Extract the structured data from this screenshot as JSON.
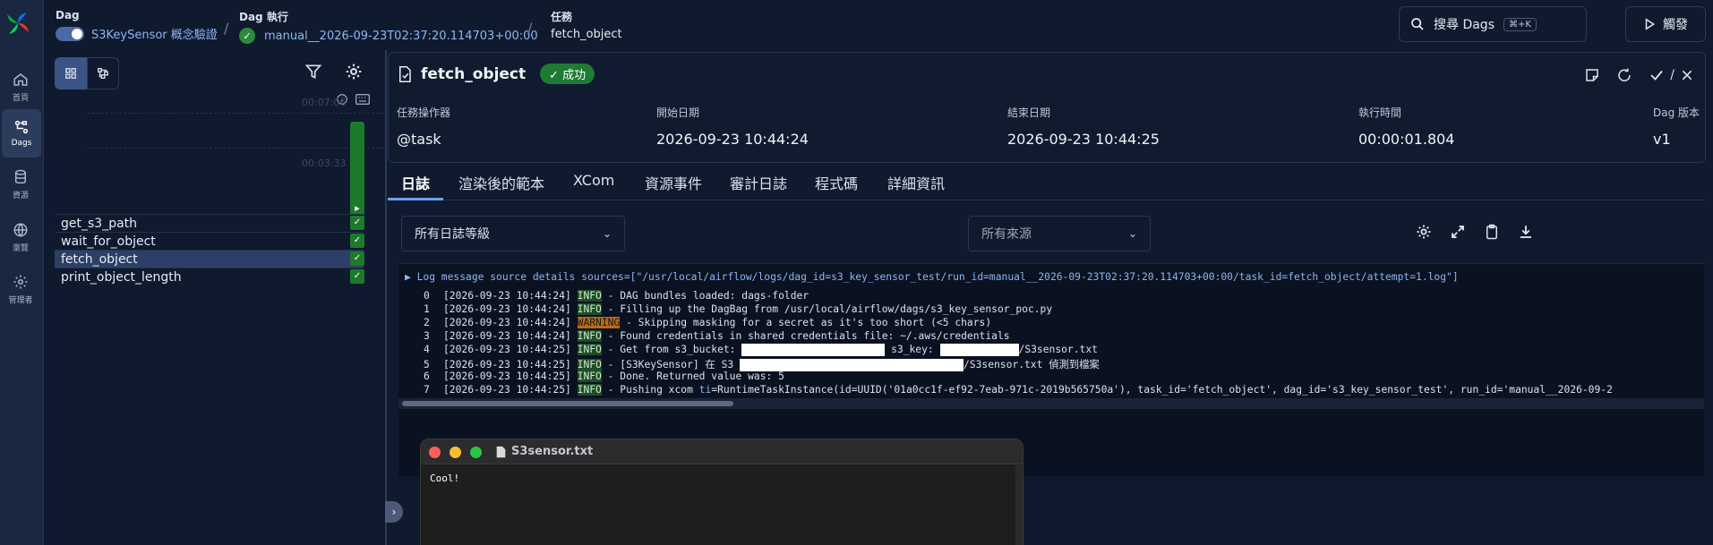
{
  "nav": {
    "items": [
      {
        "label": "首頁",
        "icon": "home-icon"
      },
      {
        "label": "Dags",
        "icon": "dags-icon",
        "active": true
      },
      {
        "label": "資源",
        "icon": "database-icon"
      },
      {
        "label": "瀏覽",
        "icon": "globe-icon"
      },
      {
        "label": "管理者",
        "icon": "gear-icon"
      }
    ]
  },
  "header": {
    "dag_label": "Dag",
    "dag_name": "S3KeySensor 概念驗證",
    "run_label": "Dag 執行",
    "run_id": "manual__2026-09-23T02:37:20.114703+00:00",
    "task_label": "任務",
    "task_name": "fetch_object",
    "search_label": "搜尋 Dags",
    "search_shortcut": "⌘+K",
    "trigger_label": "觸發"
  },
  "grid": {
    "durations": [
      "00:07:06",
      "00:03:33"
    ],
    "tasks": [
      {
        "name": "get_s3_path",
        "state": "success"
      },
      {
        "name": "wait_for_object",
        "state": "success"
      },
      {
        "name": "fetch_object",
        "state": "success",
        "selected": true
      },
      {
        "name": "print_object_length",
        "state": "success"
      }
    ]
  },
  "task_detail": {
    "title": "fetch_object",
    "status": "成功",
    "separator": "/",
    "meta": [
      {
        "label": "任務操作器",
        "value": "@task"
      },
      {
        "label": "開始日期",
        "value": "2026-09-23 10:44:24"
      },
      {
        "label": "結束日期",
        "value": "2026-09-23 10:44:25"
      },
      {
        "label": "執行時間",
        "value": "00:00:01.804"
      },
      {
        "label": "Dag 版本",
        "value": "v1"
      }
    ],
    "tabs": [
      "日誌",
      "渲染後的範本",
      "XCom",
      "資源事件",
      "審計日誌",
      "程式碼",
      "詳細資訊"
    ],
    "active_tab": "日誌"
  },
  "log": {
    "level_select": "所有日誌等級",
    "source_select_placeholder": "所有來源",
    "source_details": "▶ Log message source details sources=[\"/usr/local/airflow/logs/dag_id=s3_key_sensor_test/run_id=manual__2026-09-23T02:37:20.114703+00:00/task_id=fetch_object/attempt=1.log\"]",
    "lines": [
      {
        "n": "0",
        "ts": "[2026-09-23 10:44:24]",
        "level": "INFO",
        "msg": " - DAG bundles loaded: dags-folder"
      },
      {
        "n": "1",
        "ts": "[2026-09-23 10:44:24]",
        "level": "INFO",
        "msg": " - Filling up the DagBag from /usr/local/airflow/dags/s3_key_sensor_poc.py"
      },
      {
        "n": "2",
        "ts": "[2026-09-23 10:44:24]",
        "level": "WARNING",
        "msg": " - Skipping masking for a secret as it's too short (<5 chars)"
      },
      {
        "n": "3",
        "ts": "[2026-09-23 10:44:24]",
        "level": "INFO",
        "msg": " - Found credentials in shared credentials file: ~/.aws/credentials"
      },
      {
        "n": "4",
        "ts": "[2026-09-23 10:44:25]",
        "level": "INFO",
        "msg": " - Get from s3_bucket: ",
        "mid": " s3_key: ",
        "tail": "/S3sensor.txt"
      },
      {
        "n": "5",
        "ts": "[2026-09-23 10:44:25]",
        "level": "INFO",
        "msg": " - [S3KeySensor] 在 S3 ",
        "tail": "/S3sensor.txt 偵測到檔案"
      },
      {
        "n": "6",
        "ts": "[2026-09-23 10:44:25]",
        "level": "INFO",
        "msg": " - Done. Returned value was: 5"
      },
      {
        "n": "7",
        "ts": "[2026-09-23 10:44:25]",
        "level": "INFO",
        "msg": " - Pushing xcom ",
        "ti": "ti",
        "tail": "=RuntimeTaskInstance(id=UUID('01a0cc1f-ef92-7eab-971c-2019b565750a'), task_id='fetch_object', dag_id='s3_key_sensor_test', run_id='manual__2026-09-2"
      }
    ]
  },
  "textedit": {
    "filename": "S3sensor.txt",
    "content": "Cool!"
  },
  "colors": {
    "success": "#1d7a2c",
    "accent": "#6ea0f0",
    "warning": "#b86b14"
  }
}
